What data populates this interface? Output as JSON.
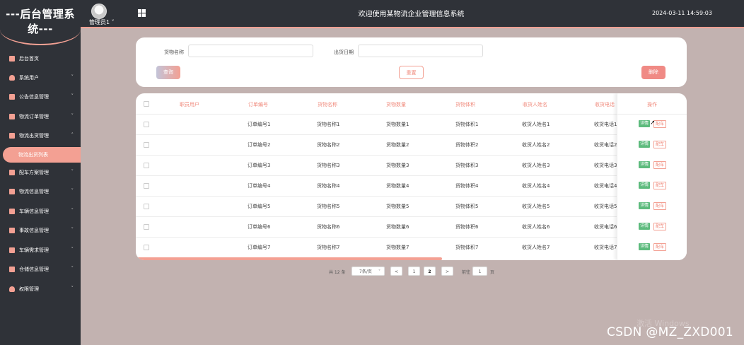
{
  "header": {
    "logo": "---后台管理系统---",
    "admin": "管理员1",
    "admin_caret": "˅",
    "title": "欢迎使用某物流企业管理信息系统",
    "datetime": "2024-03-11 14:59:03"
  },
  "sidebar": {
    "items": [
      {
        "label": "后台首页",
        "icon": "monitor-icon",
        "chevron": ""
      },
      {
        "label": "系统用户",
        "icon": "user-icon",
        "chevron": "˅"
      },
      {
        "label": "公告信息管理",
        "icon": "doc-icon",
        "chevron": "˅"
      },
      {
        "label": "物流订单管理",
        "icon": "doc-icon",
        "chevron": "˅"
      },
      {
        "label": "物流出货管理",
        "icon": "doc-icon",
        "chevron": "˄"
      },
      {
        "label": "配车方案管理",
        "icon": "doc-icon",
        "chevron": "˅"
      },
      {
        "label": "物流信息管理",
        "icon": "doc-icon",
        "chevron": "˅"
      },
      {
        "label": "车辆信息管理",
        "icon": "doc-icon",
        "chevron": "˅"
      },
      {
        "label": "事故信息管理",
        "icon": "doc-icon",
        "chevron": "˅"
      },
      {
        "label": "车辆需求管理",
        "icon": "doc-icon",
        "chevron": "˅"
      },
      {
        "label": "仓储信息管理",
        "icon": "doc-icon",
        "chevron": "˅"
      },
      {
        "label": "权限管理",
        "icon": "user-icon",
        "chevron": "˅"
      }
    ],
    "active_sub": "物流出货列表"
  },
  "search": {
    "goods_name_label": "货物名称",
    "goods_name_value": "",
    "ship_date_label": "出货日期",
    "ship_date_value": "",
    "query_btn": "查询",
    "reset_btn": "重置",
    "delete_btn": "删除"
  },
  "table": {
    "headers": [
      "职员用户",
      "订单编号",
      "货物名称",
      "货物数量",
      "货物体积",
      "收货人姓名",
      "收货电话",
      "操作"
    ],
    "rows": [
      [
        "",
        "订单编号1",
        "货物名称1",
        "货物数量1",
        "货物体积1",
        "收货人姓名1",
        "收货电话1"
      ],
      [
        "",
        "订单编号2",
        "货物名称2",
        "货物数量2",
        "货物体积2",
        "收货人姓名2",
        "收货电话2"
      ],
      [
        "",
        "订单编号3",
        "货物名称3",
        "货物数量3",
        "货物体积3",
        "收货人姓名3",
        "收货电话3"
      ],
      [
        "",
        "订单编号4",
        "货物名称4",
        "货物数量4",
        "货物体积4",
        "收货人姓名4",
        "收货电话4"
      ],
      [
        "",
        "订单编号5",
        "货物名称5",
        "货物数量5",
        "货物体积5",
        "收货人姓名5",
        "收货电话5"
      ],
      [
        "",
        "订单编号6",
        "货物名称6",
        "货物数量6",
        "货物体积6",
        "收货人姓名6",
        "收货电话6"
      ],
      [
        "",
        "订单编号7",
        "货物名称7",
        "货物数量7",
        "货物体积7",
        "收货人姓名7",
        "收货电话7"
      ]
    ],
    "detail_btn": "详情",
    "assign_btn": "配车"
  },
  "pagination": {
    "total": "共 12 条",
    "page_size": "7条/页",
    "prev": "<",
    "pages": [
      "1",
      "2"
    ],
    "current": "2",
    "next": ">",
    "goto_label": "前往",
    "goto_value": "1",
    "page_unit": "页"
  },
  "watermark": {
    "windows": "激活 Windows",
    "csdn": "CSDN @MZ_ZXD001"
  },
  "colors": {
    "accent": "#f3a093",
    "sidebar": "#2f3238",
    "background": "#c2b2b0",
    "success": "#5dbb7d"
  }
}
